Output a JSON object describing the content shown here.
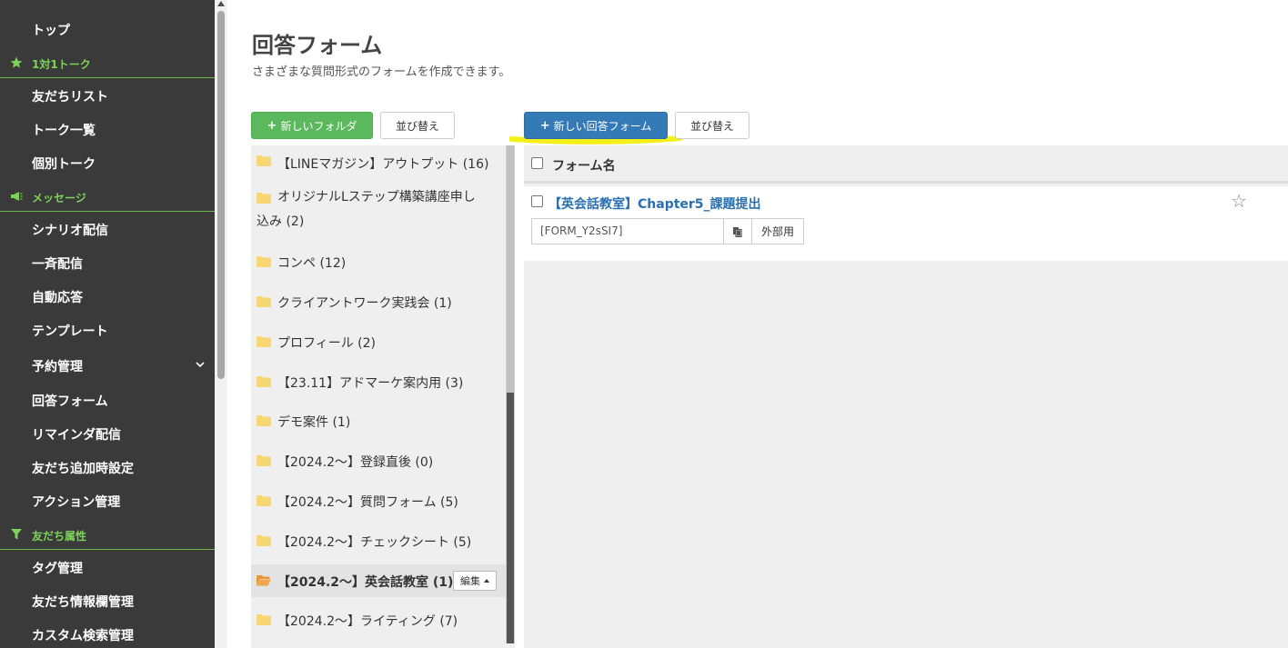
{
  "sidebar": {
    "items": [
      {
        "label": "トップ"
      },
      {
        "label": "友だちリスト"
      },
      {
        "label": "トーク一覧"
      },
      {
        "label": "個別トーク"
      },
      {
        "label": "シナリオ配信"
      },
      {
        "label": "一斉配信"
      },
      {
        "label": "自動応答"
      },
      {
        "label": "テンプレート"
      },
      {
        "label": "予約管理"
      },
      {
        "label": "回答フォーム"
      },
      {
        "label": "リマインダ配信"
      },
      {
        "label": "友だち追加時設定"
      },
      {
        "label": "アクション管理"
      },
      {
        "label": "タグ管理"
      },
      {
        "label": "友だち情報欄管理"
      },
      {
        "label": "カスタム検索管理"
      }
    ],
    "sections": [
      {
        "label": "1対1トーク",
        "icon": "star-icon"
      },
      {
        "label": "メッセージ",
        "icon": "megaphone-icon"
      },
      {
        "label": "友だち属性",
        "icon": "filter-icon"
      }
    ],
    "accent_color": "#7cd35a",
    "background": "#3a3a3a"
  },
  "header": {
    "title": "回答フォーム",
    "subtitle": "さまざまな質問形式のフォームを作成できます。"
  },
  "toolbar": {
    "new_folder_label": "新しいフォルダ",
    "sort_folders_label": "並び替え",
    "new_form_label": "新しい回答フォーム",
    "sort_forms_label": "並び替え"
  },
  "folders": [
    {
      "label": "【LINEマガジン】アウトプット (16)"
    },
    {
      "label": "オリジナルLステップ構築講座申し込み (2)"
    },
    {
      "label": "コンペ (12)"
    },
    {
      "label": "クライアントワーク実践会 (1)"
    },
    {
      "label": "プロフィール (2)"
    },
    {
      "label": "【23.11】アドマーケ案内用 (3)"
    },
    {
      "label": "デモ案件 (1)"
    },
    {
      "label": "【2024.2～】登録直後 (0)"
    },
    {
      "label": "【2024.2～】質問フォーム (5)"
    },
    {
      "label": "【2024.2～】チェックシート (5)"
    },
    {
      "label": "【2024.2～】英会話教室 (1)",
      "active": true,
      "edit_label": "編集"
    },
    {
      "label": "【2024.2～】ライティング (7)"
    }
  ],
  "forms_table": {
    "column_header": "フォーム名",
    "rows": [
      {
        "title": "【英会話教室】Chapter5_課題提出",
        "code": "[FORM_Y2sSI7]",
        "external_label": "外部用",
        "starred": false
      }
    ]
  },
  "colors": {
    "primary_blue": "#337ab7",
    "success_green": "#5cb85c",
    "link_blue": "#2a6fb0",
    "highlight_yellow": "#f5ef1a",
    "folder_yellow": "#f7d774",
    "folder_open_orange": "#f0a64a"
  }
}
